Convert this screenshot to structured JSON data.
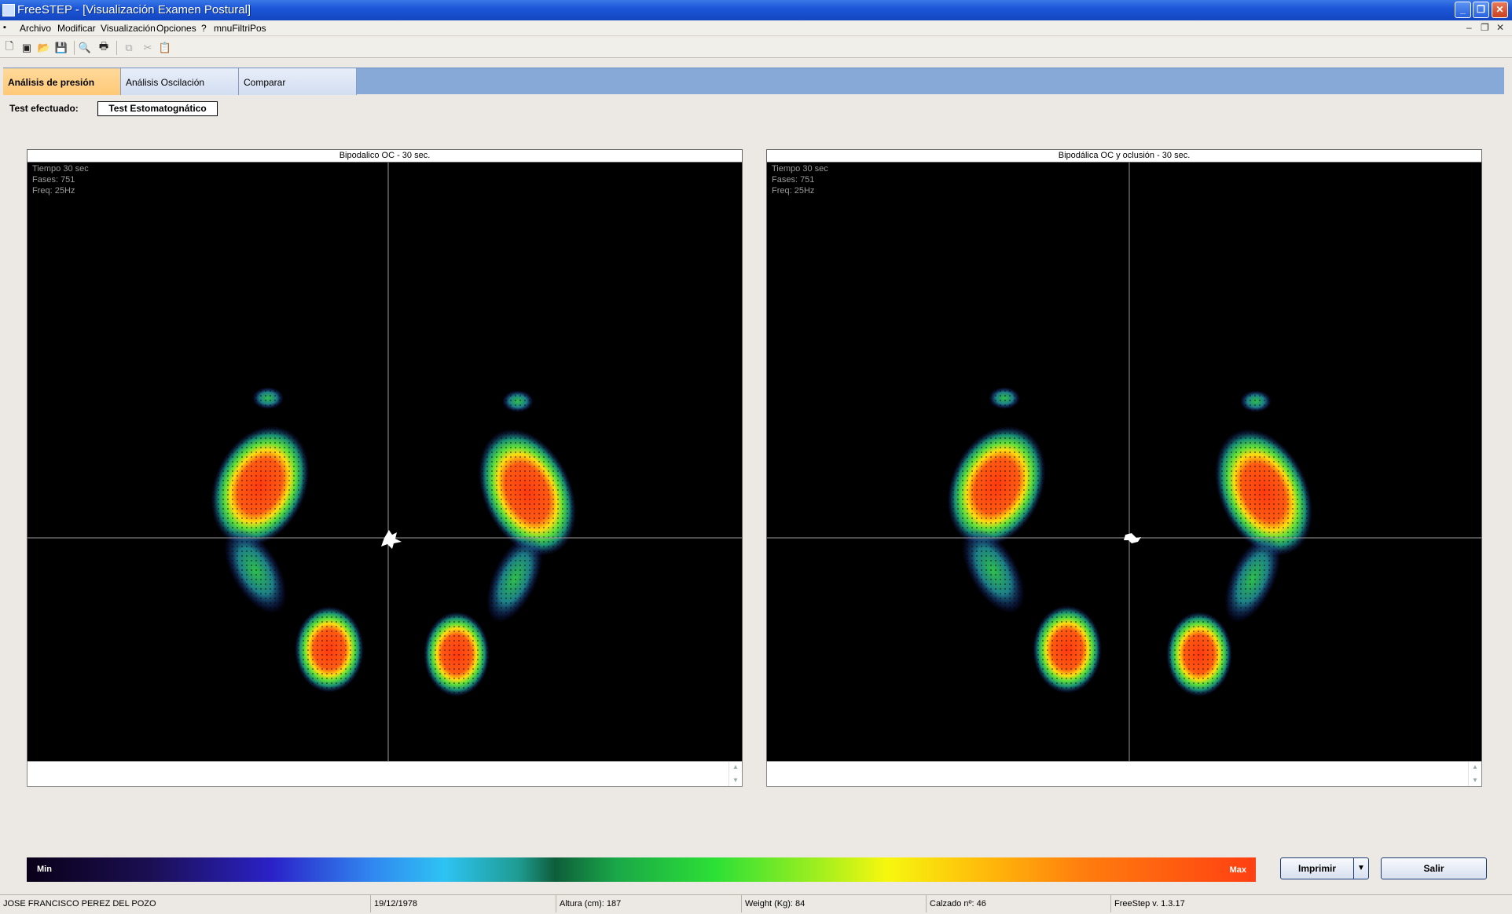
{
  "window": {
    "title": "FreeSTEP - [Visualización Examen Postural]"
  },
  "menu": {
    "items": [
      "Archivo",
      "Modificar",
      "Visualización",
      "Opciones",
      "?",
      "mnuFiltriPos"
    ]
  },
  "toolbar": {
    "buttons": [
      "new-document",
      "open-record",
      "open-folder",
      "save",
      "print-preview",
      "print",
      "copy",
      "cut",
      "paste"
    ]
  },
  "tabs": [
    {
      "label": "Análisis de presión",
      "active": true
    },
    {
      "label": "Análisis Oscilación",
      "active": false
    },
    {
      "label": "Comparar",
      "active": false
    }
  ],
  "test": {
    "label": "Test efectuado:",
    "value": "Test Estomatognático"
  },
  "panels": [
    {
      "title": "Bipodalico OC - 30 sec.",
      "info": [
        "Tiempo 30 sec",
        "Fases: 751",
        "Freq: 25Hz"
      ]
    },
    {
      "title": "Bipodálica OC y oclusión - 30 sec.",
      "info": [
        "Tiempo 30 sec",
        "Fases: 751",
        "Freq: 25Hz"
      ]
    }
  ],
  "legend": {
    "min": "Min",
    "max": "Max"
  },
  "buttons": {
    "print": "Imprimir",
    "exit": "Salir"
  },
  "status": {
    "patient": "JOSE FRANCISCO PEREZ DEL POZO",
    "birthdate": "19/12/1978",
    "height": "Altura (cm): 187",
    "weight": "Weight (Kg): 84",
    "shoe": "Calzado nº: 46",
    "version": "FreeStep v. 1.3.17"
  }
}
